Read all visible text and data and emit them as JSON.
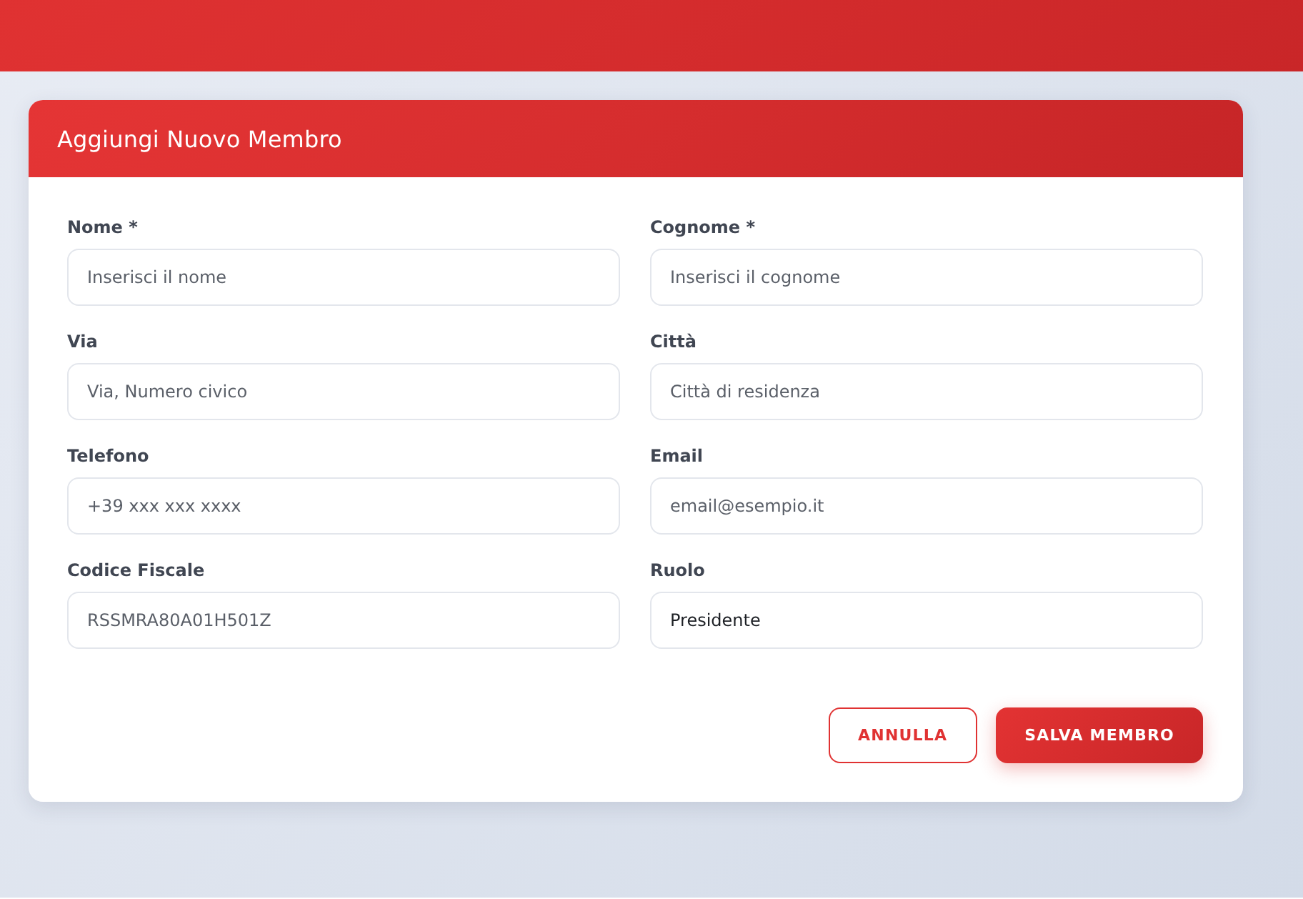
{
  "dialog": {
    "title": "Aggiungi Nuovo Membro"
  },
  "fields": [
    {
      "label": "Nome *",
      "placeholder": "Inserisci il nome"
    },
    {
      "label": "Cognome *",
      "placeholder": "Inserisci il cognome"
    },
    {
      "label": "Via",
      "placeholder": "Via, Numero civico"
    },
    {
      "label": "Città",
      "placeholder": "Città di residenza"
    },
    {
      "label": "Telefono",
      "placeholder": "+39 xxx xxx xxxx"
    },
    {
      "label": "Email",
      "placeholder": "email@esempio.it"
    },
    {
      "label": "Codice Fiscale",
      "placeholder": "RSSMRA80A01H501Z"
    },
    {
      "label": "Ruolo",
      "value": "Presidente"
    }
  ],
  "buttons": [
    {
      "label": "ANNULLA",
      "kind": "secondary"
    },
    {
      "label": "SALVA MEMBRO",
      "kind": "primary"
    }
  ]
}
